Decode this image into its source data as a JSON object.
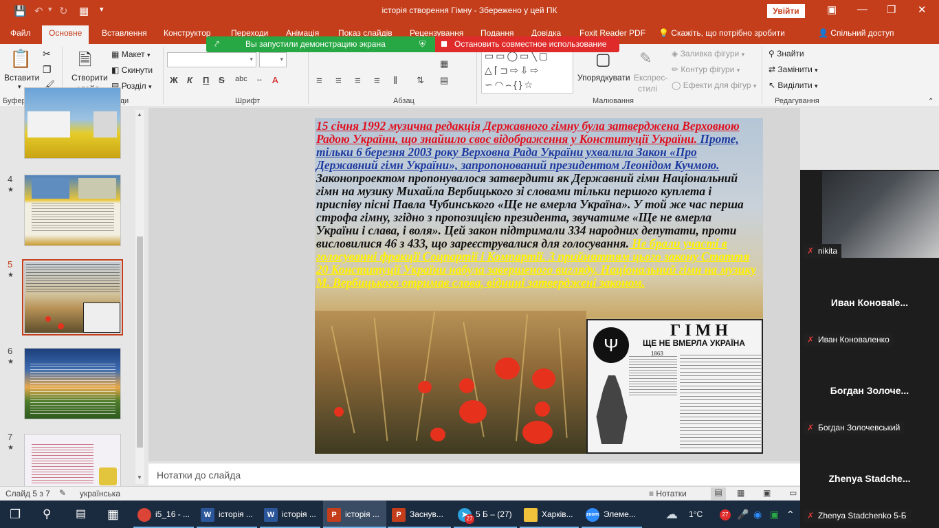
{
  "window": {
    "title": "історія створення Гімну  -  Збережено у цей ПК",
    "signin_label": "Увійти"
  },
  "tabs": [
    "Файл",
    "Основне",
    "Вставлення",
    "Конструктор",
    "Переходи",
    "Анімація",
    "Показ слайдів",
    "Рецензування",
    "Подання",
    "Довідка",
    "Foxit Reader PDF"
  ],
  "active_tab": "Основне",
  "tell_me": "Скажіть, що потрібно зробити",
  "share": "Спільний доступ",
  "screenshare": {
    "start_label": "Вы запустили демонстрацию экрана",
    "stop_label": "Остановить совместное использование",
    "start_color": "#27a844",
    "stop_color": "#e02b2b"
  },
  "ribbon": {
    "paste": "Вставити",
    "clipboard": "Буфер обміну",
    "new_slide_1": "Створити",
    "new_slide_2": "слайд",
    "layout": "Макет",
    "reset": "Скинути",
    "section": "Розділ",
    "slides": "Слайди",
    "font": "Шрифт",
    "paragraph": "Абзац",
    "arrange": "Упорядкувати",
    "quick_styles_1": "Експрес-",
    "quick_styles_2": "стилі",
    "shape_fill": "Заливка фігури",
    "shape_outline": "Контур фігури",
    "shape_effects": "Ефекти для фігур",
    "drawing": "Малювання",
    "find": "Знайти",
    "replace": "Замінити",
    "select": "Виділити",
    "editing": "Редагування",
    "bold": "Ж",
    "italic": "К",
    "underline": "П",
    "strike": "S",
    "shapes_glyphs": "▭▭◯▭╲▢\n△⌐⊐⇨⇩⇨\n⟆◠⌒{}☆"
  },
  "thumbnails": [
    {
      "num": "",
      "label": "slide-4-partial"
    },
    {
      "num": "4",
      "label": "slide-4"
    },
    {
      "num": "5",
      "label": "slide-5"
    },
    {
      "num": "6",
      "label": "slide-6"
    },
    {
      "num": "7",
      "label": "slide-7"
    }
  ],
  "slide": {
    "seg_red": "15 січня 1992 музична редакція Державного гімну була затверджена Верховною Радою України, що знайшло своє відображення у Конституції України.",
    "seg_blue": " Проте, тільки 6 березня 2003 року Верховна Рада України ухвалила Закон «Про Державний гімн України», запропонований президентом Леонідом Кучмою.",
    "seg_black": " Законопроектом пропонувалося затвердити як Державний гімн Національний гімн на музику Михайла Вербицького зі словами тільки першого куплета і приспіву пісні Павла Чубинського «Ще не вмерла Україна». У той же час перша строфа гімну, згідно з пропозицією президента, звучатиме «Ще не вмерла України і слава, і воля». Цей закон підтримали 334 народних депутати, проти висловилися 46 з 433, що зареєструвалися для голосування.",
    "seg_yellow": " Не брали участі в голосуванні фракції Соцпартії і Компартії. З прийняттям цього закону Стаття 20 Конституції України набула завершеного вигляду. Національний гімн на музику М. Вербицького отримав слова, віднині затверджені законом.",
    "anthem_title": "ГІМН",
    "anthem_subtitle": "ЩЕ НЕ ВМЕРЛА УКРАЇНА",
    "anthem_year": "1863"
  },
  "notes_placeholder": "Нотатки до слайда",
  "status": {
    "slide_counter": "Слайд 5 з 7",
    "language": "українська",
    "notes": "Нотатки"
  },
  "taskbar": {
    "items": [
      {
        "label": "i5_16 - ...",
        "icon": "chrome-icon",
        "color": "#db4437"
      },
      {
        "label": "історія ...",
        "icon": "word-icon",
        "color": "#2b579a"
      },
      {
        "label": "історія ...",
        "icon": "word-icon",
        "color": "#2b579a"
      },
      {
        "label": "історія ...",
        "icon": "powerpoint-icon",
        "color": "#c43e1c"
      },
      {
        "label": "Заснув...",
        "icon": "powerpoint-icon",
        "color": "#c43e1c"
      },
      {
        "label": "5 Б – (27)",
        "icon": "telegram-icon",
        "color": "#2aa3df"
      },
      {
        "label": "Харків...",
        "icon": "folder-icon",
        "color": "#f0c23b"
      },
      {
        "label": "Элеме...",
        "icon": "zoom-icon",
        "color": "#2d8cff"
      }
    ],
    "temperature": "1°C",
    "badge": "27"
  },
  "participants": [
    {
      "name": "nikita",
      "display": ""
    },
    {
      "name": "Иван Коноваленко",
      "display": "Иван  Коноваle..."
    },
    {
      "name": "Богдан Золочевський",
      "display": "Богдан  Золоче..."
    },
    {
      "name": "Zhenya Stadchenko 5-Б",
      "display": "Zhenya  Stadche..."
    }
  ]
}
